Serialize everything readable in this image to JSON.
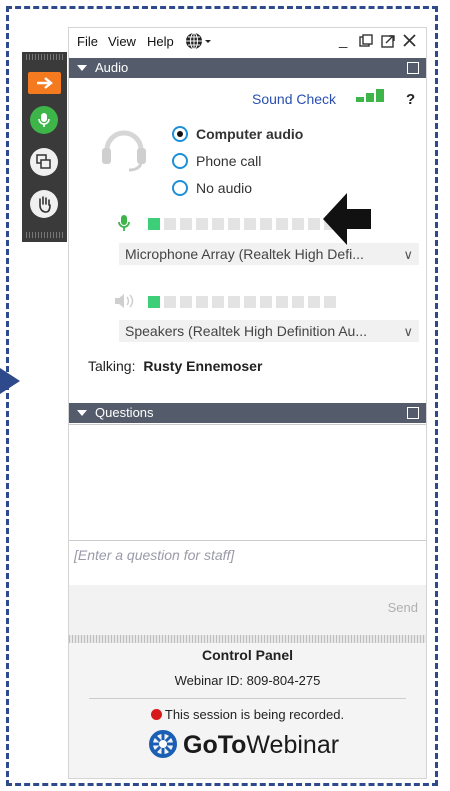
{
  "menu": {
    "file": "File",
    "view": "View",
    "help": "Help"
  },
  "audio": {
    "section_title": "Audio",
    "sound_check": "Sound Check",
    "options": [
      {
        "label": "Computer audio",
        "selected": true
      },
      {
        "label": "Phone call",
        "selected": false
      },
      {
        "label": "No audio",
        "selected": false
      }
    ],
    "mic_device": "Microphone Array (Realtek High Defi...",
    "speaker_device": "Speakers (Realtek High Definition Au...",
    "talking_label": "Talking:",
    "talking_name": "Rusty Ennemoser",
    "mic_level_segments_on": 1,
    "speaker_level_segments_on": 1,
    "total_segments": 12
  },
  "questions": {
    "section_title": "Questions",
    "placeholder": "[Enter a question for staff]",
    "send_label": "Send"
  },
  "footer": {
    "title": "Control Panel",
    "webinar_id": "Webinar ID: 809-804-275",
    "recording_notice": "This session is being recorded.",
    "brand_bold": "GoTo",
    "brand_light": "Webinar"
  },
  "colors": {
    "accent_green": "#3eb549",
    "toolbar_orange": "#f47a20",
    "section_bar": "#545b6b",
    "link_blue": "#2a4fb0",
    "frame_blue": "#2e4a8c"
  }
}
